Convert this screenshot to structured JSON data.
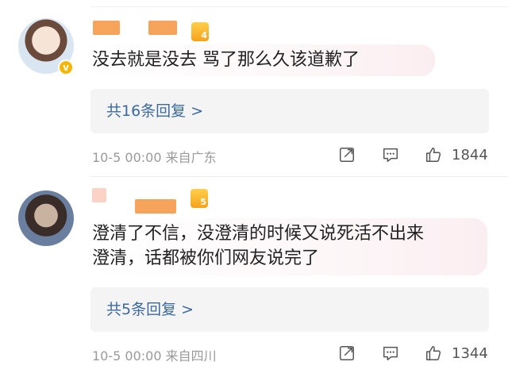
{
  "comments": [
    {
      "text_lines": [
        "没去就是没去 骂了那么久该道歉了"
      ],
      "replies_label": "共16条回复 >",
      "time": "10-5 00:00",
      "location": "来自广东",
      "likes": "1844",
      "level": "4",
      "verified_mark": "v"
    },
    {
      "text_lines": [
        "澄清了不信，没澄清的时候又说死活不出来",
        "澄清，话都被你们网友说完了"
      ],
      "replies_label": "共5条回复 >",
      "time": "10-5 00:00",
      "location": "来自四川",
      "likes": "1344",
      "level": "5"
    }
  ],
  "colors": {
    "link": "#3c6a9c",
    "name_blur": "#f6a35c",
    "meta": "#9a9a9a",
    "badge": "#f7b500"
  },
  "icons": [
    "share-icon",
    "comment-icon",
    "like-icon"
  ]
}
